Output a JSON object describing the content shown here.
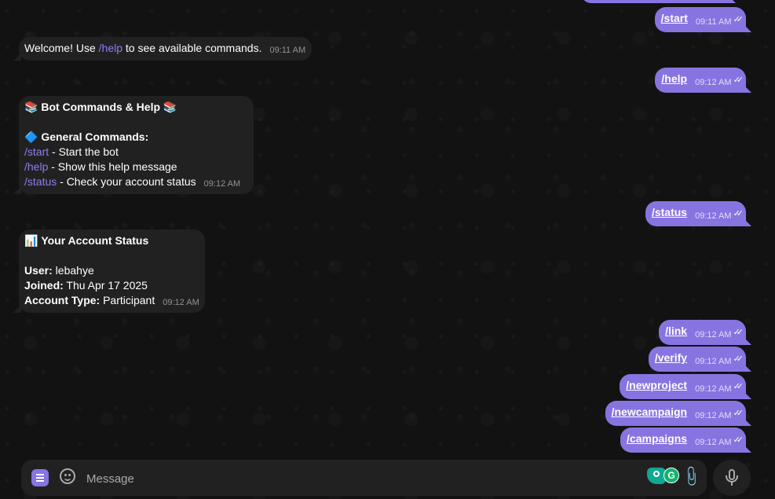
{
  "messages": {
    "out_top_partial": {
      "text": ""
    },
    "out_start": {
      "text": "/start",
      "time": "09:11 AM"
    },
    "in_welcome": {
      "pre": "Welcome! Use ",
      "cmd": "/help",
      "post": " to see available commands.",
      "time": "09:11 AM"
    },
    "out_help": {
      "text": "/help",
      "time": "09:12 AM"
    },
    "in_help_card": {
      "title_emoji": "📚",
      "title": "Bot Commands & Help",
      "section_emoji": "🔷",
      "section": "General Commands:",
      "commands": [
        {
          "cmd": "/start",
          "desc": " - Start the bot"
        },
        {
          "cmd": "/help",
          "desc": " - Show this help message"
        },
        {
          "cmd": "/status",
          "desc": " - Check your account status"
        }
      ],
      "time": "09:12 AM"
    },
    "out_status": {
      "text": "/status",
      "time": "09:12 AM"
    },
    "in_status_card": {
      "title_emoji": "📊",
      "title": "Your Account Status",
      "user_label": "User:",
      "user_value": " lebahye",
      "joined_label": "Joined:",
      "joined_value": " Thu Apr 17 2025",
      "type_label": "Account Type:",
      "type_value": " Participant",
      "time": "09:12 AM"
    },
    "out_link": {
      "text": "/link",
      "time": "09:12 AM"
    },
    "out_verify": {
      "text": "/verify",
      "time": "09:12 AM"
    },
    "out_newproject": {
      "text": "/newproject",
      "time": "09:12 AM"
    },
    "out_newcampaign": {
      "text": "/newcampaign",
      "time": "09:12 AM"
    },
    "out_campaigns": {
      "text": "/campaigns",
      "time": "09:12 AM"
    }
  },
  "composer": {
    "placeholder": "Message"
  },
  "icons": {
    "menu": "bot-menu-icon",
    "emoji": "smile-icon",
    "ext_a": "extension-icon",
    "ext_b": "grammarly-icon",
    "attach": "paperclip-icon",
    "mic": "microphone-icon",
    "ext_b_letter": "G"
  },
  "colors": {
    "outgoing": "#8774e1",
    "incoming": "#212121",
    "background": "#0f0f0f"
  }
}
